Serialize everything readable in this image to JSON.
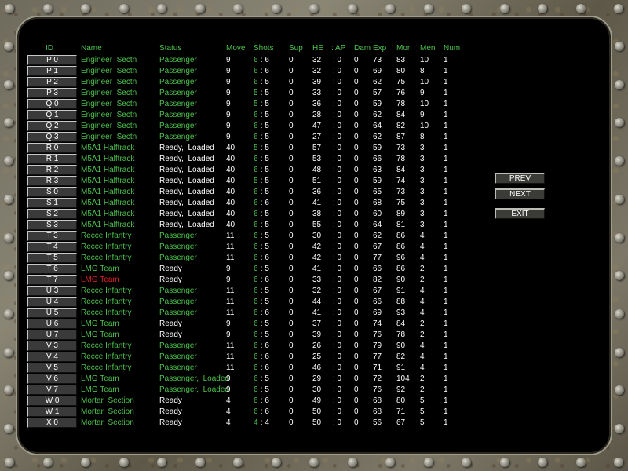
{
  "colors": {
    "green": "#4cc34c",
    "white": "#ffffff",
    "red": "#e02020",
    "panel": "#000000"
  },
  "headers": [
    "ID",
    "Name",
    "Status",
    "Move",
    "Shots",
    "Sup",
    "HE",
    ": AP",
    "Dam",
    "Exp",
    "Mor",
    "Men",
    "Num"
  ],
  "buttons": {
    "prev": "PREV",
    "next": "NEXT",
    "exit": "EXIT"
  },
  "rows": [
    [
      "P 0",
      "Engineer  Sectn",
      "Passenger",
      "9",
      "6",
      " : 6",
      "0",
      "32",
      ": 0",
      "0",
      "73",
      "83",
      "10",
      "1"
    ],
    [
      "P 1",
      "Engineer  Sectn",
      "Passenger",
      "9",
      "6",
      " : 6",
      "0",
      "32",
      ": 0",
      "0",
      "69",
      "80",
      "8",
      "1"
    ],
    [
      "P 2",
      "Engineer  Sectn",
      "Passenger",
      "9",
      "6",
      " : 5",
      "0",
      "39",
      ": 0",
      "0",
      "62",
      "75",
      "10",
      "1"
    ],
    [
      "P 3",
      "Engineer  Sectn",
      "Passenger",
      "9",
      "5",
      " : 5",
      "0",
      "33",
      ": 0",
      "0",
      "57",
      "76",
      "9",
      "1"
    ],
    [
      "Q 0",
      "Engineer  Sectn",
      "Passenger",
      "9",
      "5",
      " : 5",
      "0",
      "36",
      ": 0",
      "0",
      "59",
      "78",
      "10",
      "1"
    ],
    [
      "Q 1",
      "Engineer  Sectn",
      "Passenger",
      "9",
      "6",
      " : 5",
      "0",
      "28",
      ": 0",
      "0",
      "62",
      "84",
      "9",
      "1"
    ],
    [
      "Q 2",
      "Engineer  Sectn",
      "Passenger",
      "9",
      "6",
      " : 5",
      "0",
      "47",
      ": 0",
      "0",
      "64",
      "82",
      "10",
      "1"
    ],
    [
      "Q 3",
      "Engineer  Sectn",
      "Passenger",
      "9",
      "6",
      " : 5",
      "0",
      "27",
      ": 0",
      "0",
      "62",
      "87",
      "8",
      "1"
    ],
    [
      "R 0",
      "M5A1 Halftrack",
      "Ready,  Loaded",
      "40",
      "5",
      " : 5",
      "0",
      "57",
      ": 0",
      "0",
      "59",
      "73",
      "3",
      "1"
    ],
    [
      "R 1",
      "M5A1 Halftrack",
      "Ready,  Loaded",
      "40",
      "6",
      " : 5",
      "0",
      "53",
      ": 0",
      "0",
      "66",
      "78",
      "3",
      "1"
    ],
    [
      "R 2",
      "M5A1 Halftrack",
      "Ready,  Loaded",
      "40",
      "6",
      " : 5",
      "0",
      "48",
      ": 0",
      "0",
      "63",
      "84",
      "3",
      "1"
    ],
    [
      "R 3",
      "M5A1 Halftrack",
      "Ready,  Loaded",
      "40",
      "5",
      " : 5",
      "0",
      "51",
      ": 0",
      "0",
      "59",
      "74",
      "3",
      "1"
    ],
    [
      "S 0",
      "M5A1 Halftrack",
      "Ready,  Loaded",
      "40",
      "6",
      " : 5",
      "0",
      "36",
      ": 0",
      "0",
      "65",
      "73",
      "3",
      "1"
    ],
    [
      "S 1",
      "M5A1 Halftrack",
      "Ready,  Loaded",
      "40",
      "6",
      " : 6",
      "0",
      "41",
      ": 0",
      "0",
      "68",
      "75",
      "3",
      "1"
    ],
    [
      "S 2",
      "M5A1 Halftrack",
      "Ready,  Loaded",
      "40",
      "6",
      " : 5",
      "0",
      "38",
      ": 0",
      "0",
      "60",
      "89",
      "3",
      "1"
    ],
    [
      "S 3",
      "M5A1 Halftrack",
      "Ready,  Loaded",
      "40",
      "6",
      " : 5",
      "0",
      "55",
      ": 0",
      "0",
      "64",
      "81",
      "3",
      "1"
    ],
    [
      "T 3",
      "Recce Infantry",
      "Passenger",
      "11",
      "6",
      " : 5",
      "0",
      "30",
      ": 0",
      "0",
      "62",
      "86",
      "4",
      "1"
    ],
    [
      "T 4",
      "Recce Infantry",
      "Passenger",
      "11",
      "6",
      " : 5",
      "0",
      "42",
      ": 0",
      "0",
      "67",
      "86",
      "4",
      "1"
    ],
    [
      "T 5",
      "Recce Infantry",
      "Passenger",
      "11",
      "6",
      " : 6",
      "0",
      "42",
      ": 0",
      "0",
      "77",
      "96",
      "4",
      "1"
    ],
    [
      "T 6",
      "LMG Team",
      "Ready",
      "9",
      "6",
      " : 5",
      "0",
      "41",
      ": 0",
      "0",
      "66",
      "86",
      "2",
      "1"
    ],
    [
      "T 7",
      "LMG Team",
      "Ready",
      "9",
      "6",
      " : 6",
      "0",
      "33",
      ": 0",
      "0",
      "82",
      "90",
      "2",
      "1"
    ],
    [
      "U 3",
      "Recce Infantry",
      "Passenger",
      "11",
      "6",
      " : 5",
      "0",
      "32",
      ": 0",
      "0",
      "67",
      "91",
      "4",
      "1"
    ],
    [
      "U 4",
      "Recce Infantry",
      "Passenger",
      "11",
      "6",
      " : 5",
      "0",
      "44",
      ": 0",
      "0",
      "66",
      "88",
      "4",
      "1"
    ],
    [
      "U 5",
      "Recce Infantry",
      "Passenger",
      "11",
      "6",
      " : 6",
      "0",
      "41",
      ": 0",
      "0",
      "69",
      "93",
      "4",
      "1"
    ],
    [
      "U 6",
      "LMG Team",
      "Ready",
      "9",
      "6",
      " : 5",
      "0",
      "37",
      ": 0",
      "0",
      "74",
      "84",
      "2",
      "1"
    ],
    [
      "U 7",
      "LMG Team",
      "Ready",
      "9",
      "6",
      " : 5",
      "0",
      "39",
      ": 0",
      "0",
      "76",
      "78",
      "2",
      "1"
    ],
    [
      "V 3",
      "Recce Infantry",
      "Passenger",
      "11",
      "6",
      " : 6",
      "0",
      "26",
      ": 0",
      "0",
      "79",
      "90",
      "4",
      "1"
    ],
    [
      "V 4",
      "Recce Infantry",
      "Passenger",
      "11",
      "6",
      " : 6",
      "0",
      "25",
      ": 0",
      "0",
      "77",
      "82",
      "4",
      "1"
    ],
    [
      "V 5",
      "Recce Infantry",
      "Passenger",
      "11",
      "6",
      " : 6",
      "0",
      "46",
      ": 0",
      "0",
      "71",
      "91",
      "4",
      "1"
    ],
    [
      "V 6",
      "LMG Team",
      "Passenger,  Loaded",
      "9",
      "6",
      " : 5",
      "0",
      "29",
      ": 0",
      "0",
      "72",
      "104",
      "2",
      "1"
    ],
    [
      "V 7",
      "LMG Team",
      "Passenger,  Loaded",
      "9",
      "6",
      " : 5",
      "0",
      "30",
      ": 0",
      "0",
      "76",
      "92",
      "2",
      "1"
    ],
    [
      "W 0",
      "Mortar  Section",
      "Ready",
      "4",
      "6",
      " : 6",
      "0",
      "49",
      ": 0",
      "0",
      "68",
      "80",
      "5",
      "1"
    ],
    [
      "W 1",
      "Mortar  Section",
      "Ready",
      "4",
      "6",
      " : 6",
      "0",
      "50",
      ": 0",
      "0",
      "68",
      "71",
      "5",
      "1"
    ],
    [
      "X 0",
      "Mortar  Section",
      "Ready",
      "4",
      "4",
      " : 4",
      "0",
      "50",
      ": 0",
      "0",
      "56",
      "67",
      "5",
      "1"
    ]
  ],
  "selected_row_id": "T 7"
}
